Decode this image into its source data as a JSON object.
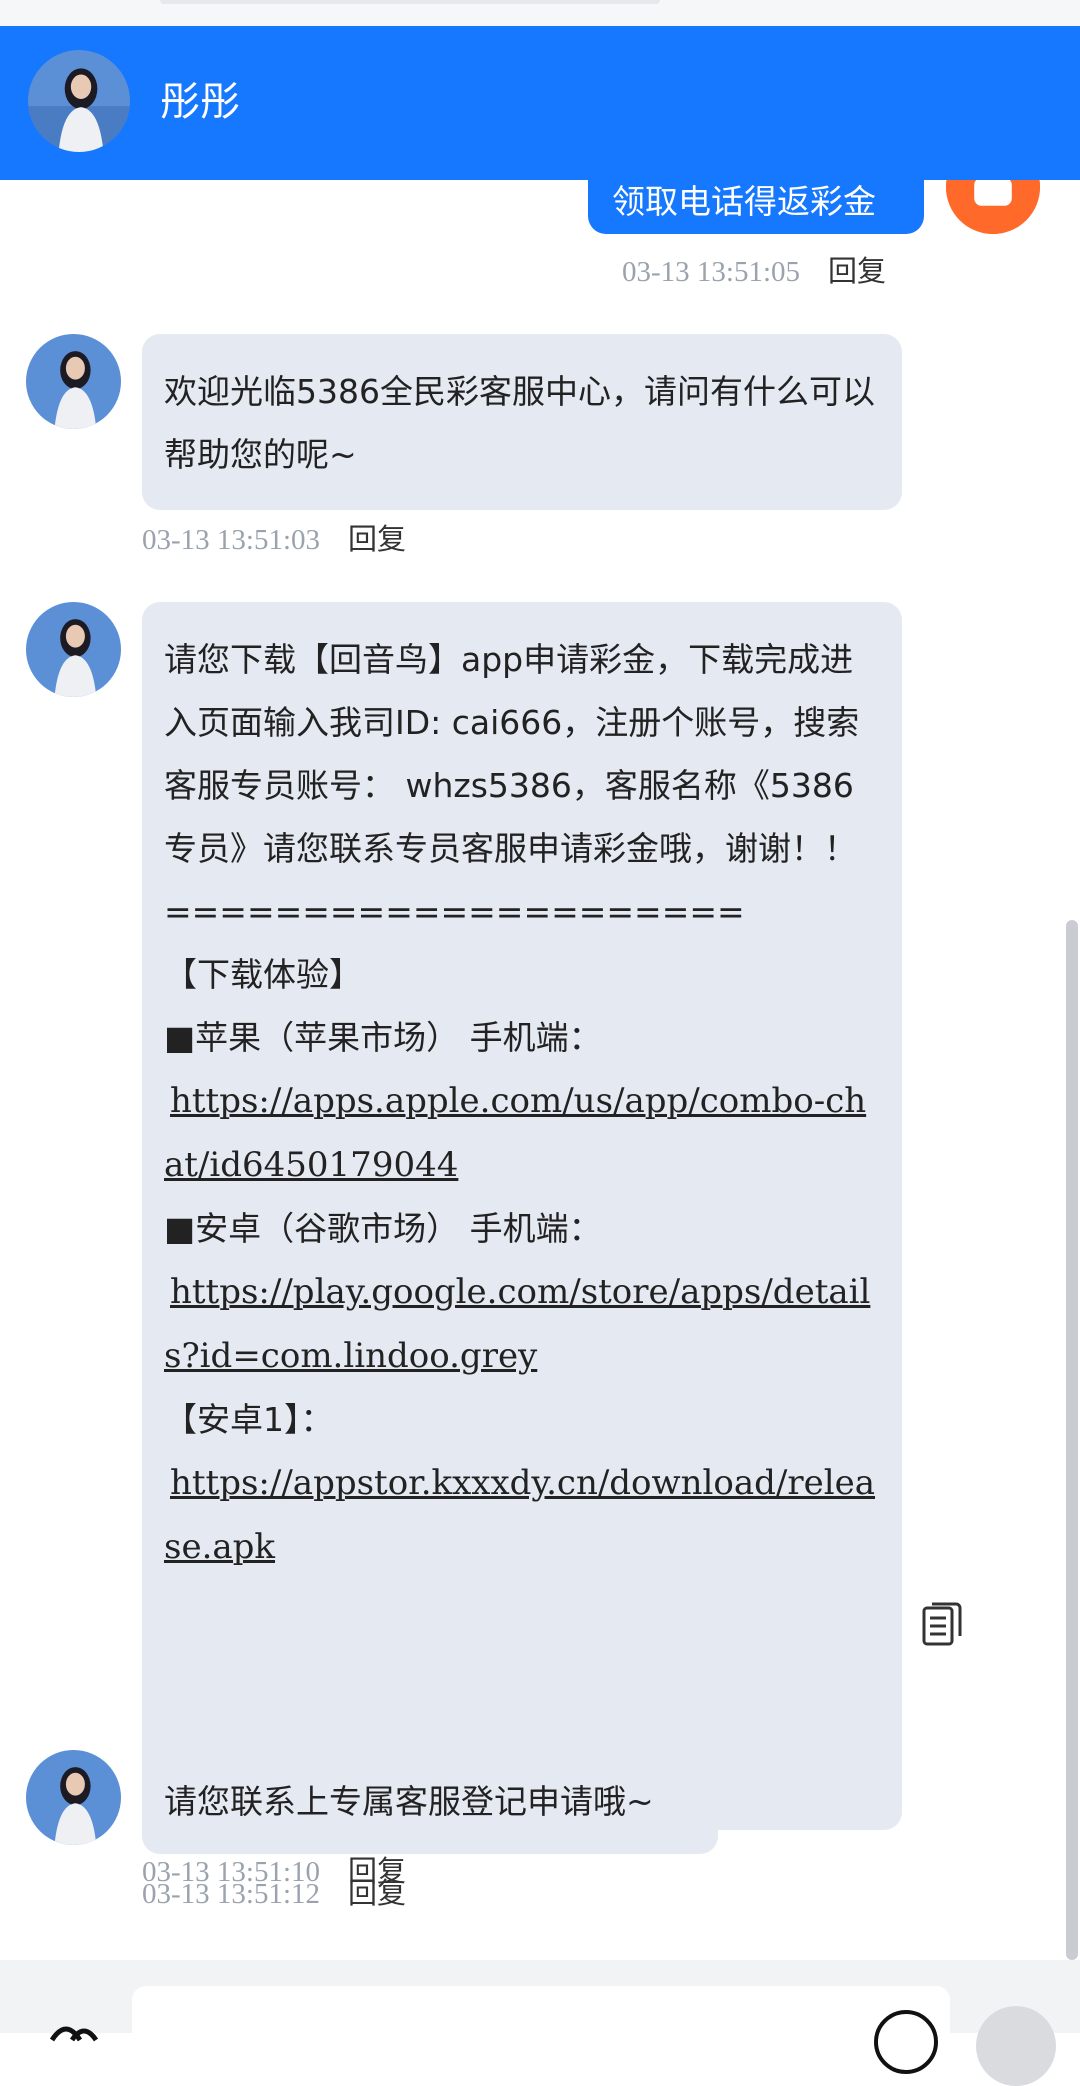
{
  "header": {
    "contact_name": "彤彤"
  },
  "messages": [
    {
      "from": "user",
      "text": "领取电话得返彩金",
      "time": "03-13 13:51:05",
      "reply": "回复"
    },
    {
      "from": "agent",
      "lines": [
        "欢迎光临5386全民彩客服中心，请问有什么可以帮助您的呢~"
      ],
      "time": "03-13 13:51:03",
      "reply": "回复"
    },
    {
      "from": "agent",
      "text_intro": "请您下载【回音鸟】app申请彩金，下载完成进入页面输入我司ID: cai666，注册个账号，搜索客服专员账号： whzs5386，客服名称《5386专员》请您联系专员客服申请彩金哦，谢谢！！",
      "separator": "=====================",
      "section_title": "【下载体验】",
      "apple_label": "■苹果（苹果市场） 手机端：",
      "apple_link": "https://apps.apple.com/us/app/combo-chat/id6450179044",
      "android_label": "■安卓（谷歌市场） 手机端：",
      "android_link": "https://play.google.com/store/apps/details?id=com.lindoo.grey",
      "android1_label": "【安卓1】：",
      "android1_link": "https://appstor.kxxxdy.cn/download/release.apk",
      "time": "03-13 13:51:10",
      "reply": "回复"
    },
    {
      "from": "agent",
      "lines": [
        "请您联系上专属客服登记申请哦~"
      ],
      "time": "03-13 13:51:12",
      "reply": "回复"
    }
  ],
  "icons": [
    "copy-icon",
    "emoji-icon",
    "plus-icon",
    "voice-icon"
  ],
  "colors": {
    "header": "#1677ff",
    "bubble": "#e4e9f2",
    "user_avatar": "#ff6a2a"
  }
}
